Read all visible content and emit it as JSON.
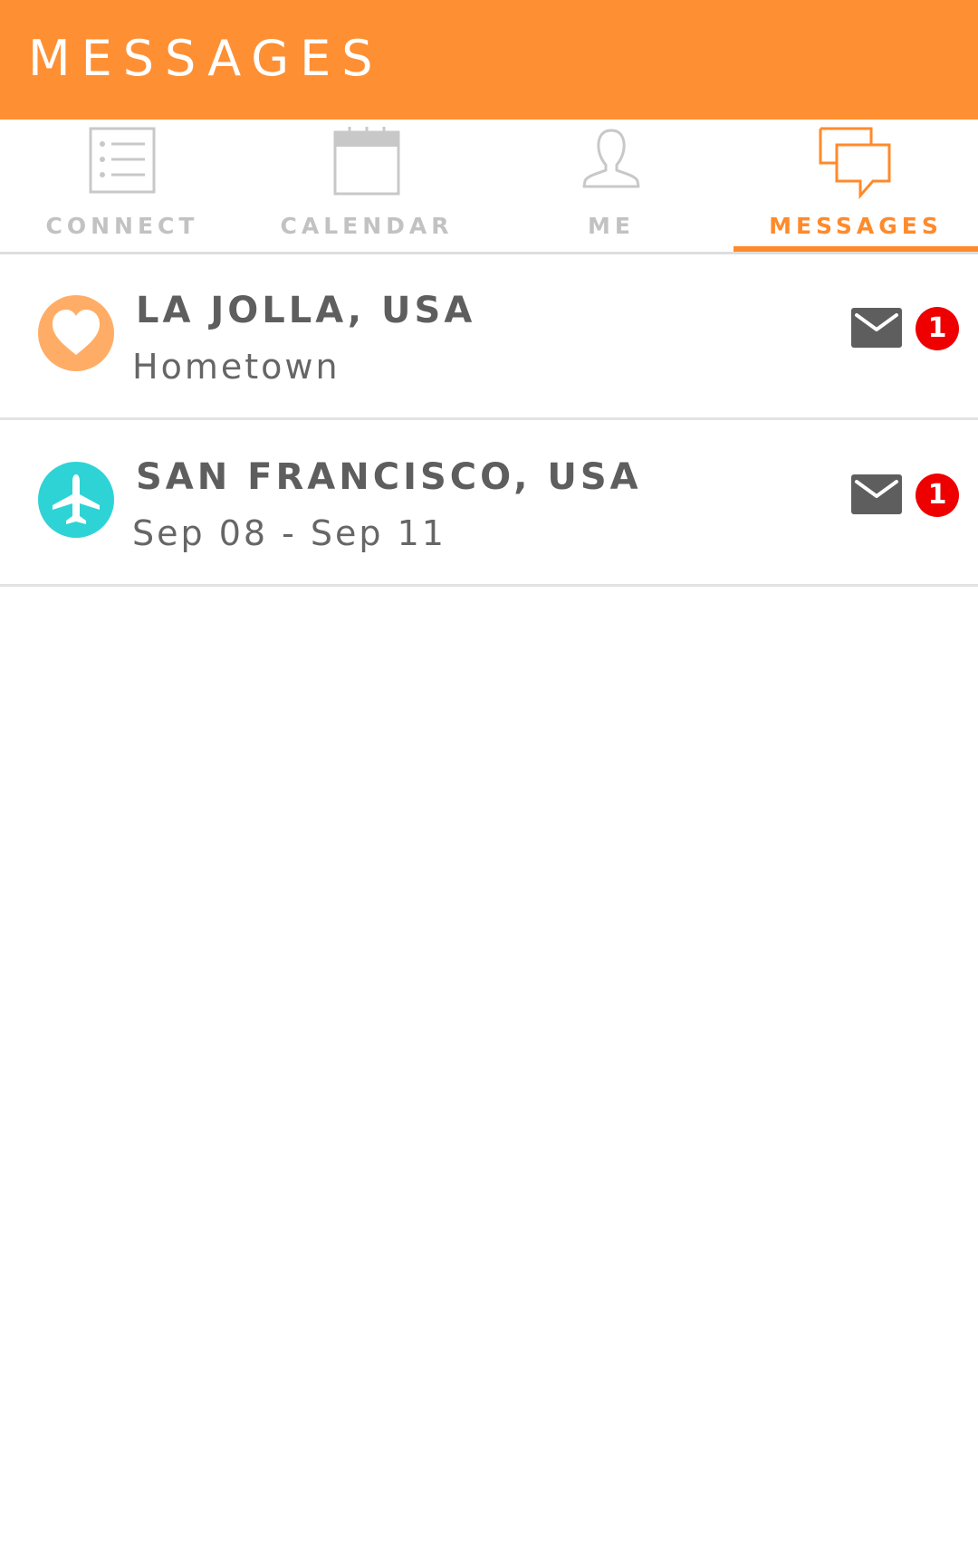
{
  "header": {
    "title": "MESSAGES",
    "bg_color": "#ff8f33"
  },
  "tabs": [
    {
      "label": "CONNECT",
      "icon": "list-icon",
      "active": false
    },
    {
      "label": "CALENDAR",
      "icon": "calendar-icon",
      "active": false
    },
    {
      "label": "ME",
      "icon": "person-icon",
      "active": false
    },
    {
      "label": "MESSAGES",
      "icon": "chat-bubbles-icon",
      "active": true
    }
  ],
  "accent_color": "#ff8a2b",
  "inactive_color": "#c2c2c2",
  "conversations": [
    {
      "title": "LA JOLLA, USA",
      "subtitle": "Hometown",
      "icon": "heart-icon",
      "icon_bg": "#ffad66",
      "unread": "1"
    },
    {
      "title": "SAN FRANCISCO, USA",
      "subtitle": "Sep 08 - Sep 11",
      "icon": "airplane-icon",
      "icon_bg": "#2ed3d6",
      "unread": "1"
    }
  ],
  "badge_color": "#ee0000"
}
